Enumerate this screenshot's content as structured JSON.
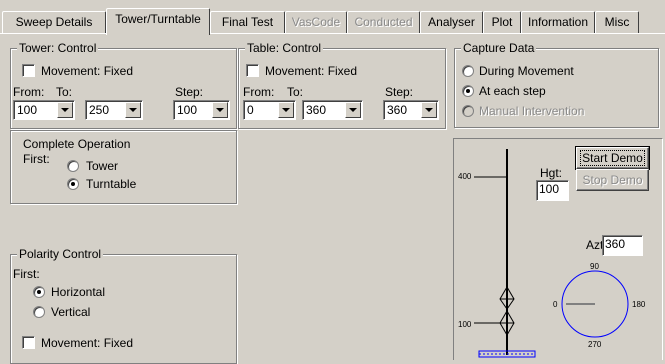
{
  "tabs": [
    {
      "label": "Sweep Details",
      "state": "normal"
    },
    {
      "label": "Tower/Turntable",
      "state": "active"
    },
    {
      "label": "Final Test",
      "state": "normal"
    },
    {
      "label": "VasCode",
      "state": "disabled"
    },
    {
      "label": "Conducted",
      "state": "disabled"
    },
    {
      "label": "Analyser",
      "state": "normal"
    },
    {
      "label": "Plot",
      "state": "normal"
    },
    {
      "label": "Information",
      "state": "normal"
    },
    {
      "label": "Misc",
      "state": "normal"
    }
  ],
  "tower_control": {
    "legend": "Tower: Control",
    "movement_label": "Movement: Fixed",
    "movement_checked": false,
    "from_label": "From:",
    "to_label": "To:",
    "step_label": "Step:",
    "from_value": "100",
    "to_value": "250",
    "step_value": "100"
  },
  "table_control": {
    "legend": "Table: Control",
    "movement_label": "Movement: Fixed",
    "movement_checked": false,
    "from_label": "From:",
    "to_label": "To:",
    "step_label": "Step:",
    "from_value": "0",
    "to_value": "360",
    "step_value": "360"
  },
  "capture_data": {
    "legend": "Capture Data",
    "options": [
      {
        "label": "During Movement",
        "selected": false,
        "disabled": false
      },
      {
        "label": "At each step",
        "selected": true,
        "disabled": false
      },
      {
        "label": "Manual Intervention",
        "selected": false,
        "disabled": true
      }
    ]
  },
  "complete_operation": {
    "title": "Complete Operation",
    "first_label": "First:",
    "options": [
      {
        "label": "Tower",
        "selected": false
      },
      {
        "label": "Turntable",
        "selected": true
      }
    ]
  },
  "polarity_control": {
    "legend": "Polarity Control",
    "first_label": "First:",
    "options": [
      {
        "label": "Horizontal",
        "selected": true
      },
      {
        "label": "Vertical",
        "selected": false
      }
    ],
    "movement_label": "Movement: Fixed",
    "movement_checked": false
  },
  "demo": {
    "start_label": "Start Demo",
    "stop_label": "Stop Demo",
    "height_label": "Hgt:",
    "height_value": "100",
    "azimuth_label": "Azt:",
    "azimuth_value": "360",
    "tower_top_label": "400",
    "tower_bottom_label": "100",
    "compass": {
      "north": "90",
      "west": "0",
      "east": "180",
      "south": "270"
    },
    "colors": {
      "compass": "#0000ff",
      "base": "#0000ff"
    }
  }
}
